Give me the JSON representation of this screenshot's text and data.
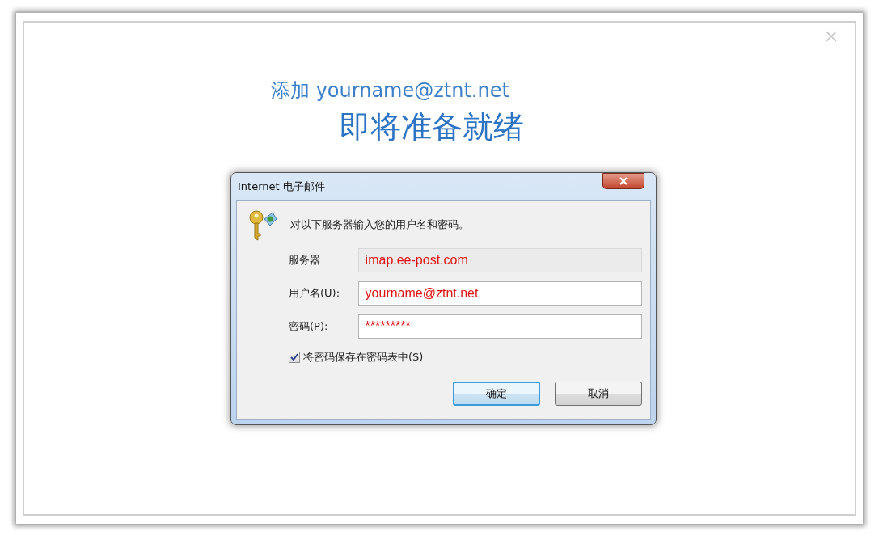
{
  "header": {
    "title": "添加 yourname@ztnt.net",
    "status": "即将准备就绪"
  },
  "dialog": {
    "title": "Internet 电子邮件",
    "prompt": "对以下服务器输入您的用户名和密码。",
    "fields": [
      {
        "label": "服务器",
        "value": "imap.ee-post.com",
        "disabled": true
      },
      {
        "label": "用户名(U):",
        "value": "yourname@ztnt.net",
        "disabled": false
      },
      {
        "label": "密码(P):",
        "value": "*********",
        "disabled": false
      }
    ],
    "remember": {
      "label": "将密码保存在密码表中(S)",
      "checked": true
    },
    "buttons": [
      {
        "label": "确定",
        "default": true
      },
      {
        "label": "取消",
        "default": false
      }
    ]
  }
}
